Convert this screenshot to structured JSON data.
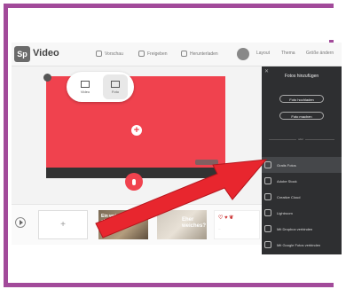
{
  "app": {
    "logo_badge": "Sp",
    "title": "Video"
  },
  "header": {
    "preview": "Vorschau",
    "share": "Freigeben",
    "download": "Herunterladen",
    "layout": "Layout",
    "theme": "Thema",
    "resize": "Größe ändern"
  },
  "media_popup": {
    "video_label": "Video",
    "photo_label": "Foto"
  },
  "canvas": {
    "color": "#f0424e",
    "add_symbol": "+"
  },
  "filmstrip": {
    "add_symbol": "+",
    "thumb1_text": "Ein weiches Linie als Haustier!",
    "thumb2_text": "Eher weiches?",
    "thumb3_text": "♡ ♥ ❦",
    "thumb3_sub": "..."
  },
  "panel": {
    "close_symbol": "✕",
    "title": "Fotos hinzufügen",
    "upload_button": "Foto hochladen",
    "take_button": "Foto machen",
    "or_label": "oder",
    "items": [
      {
        "label": "Gratis Fotos",
        "icon": "search-icon",
        "active": true
      },
      {
        "label": "Adobe Stock",
        "icon": "stock-icon",
        "active": false
      },
      {
        "label": "Creative Cloud",
        "icon": "cloud-icon",
        "active": false
      },
      {
        "label": "Lightroom",
        "icon": "lightroom-icon",
        "active": false
      },
      {
        "label": "Mit Dropbox verbinden",
        "icon": "dropbox-icon",
        "active": false
      },
      {
        "label": "Mit Google Fotos verbinden",
        "icon": "google-photos-icon",
        "active": false
      }
    ]
  },
  "annotation": {
    "arrow_color": "#e8262e",
    "frame_color": "#a24a9a"
  }
}
